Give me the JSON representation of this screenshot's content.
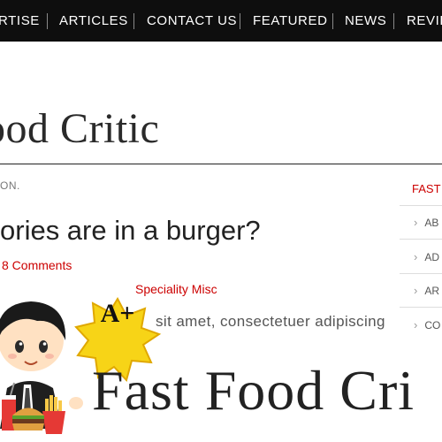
{
  "nav": {
    "items": [
      "RTISE",
      "ARTICLES",
      "CONTACT US",
      "FEATURED",
      "NEWS",
      "REVIE"
    ]
  },
  "header": {
    "site_title": "ood Critic"
  },
  "breadcrumb": {
    "tail": "ON."
  },
  "post": {
    "title": "ories are in a burger?",
    "comments": "8 Comments",
    "categories": "Speciality Misc",
    "excerpt_before": "",
    "excerpt_after": "sit amet, consectetuer adipiscing"
  },
  "sidebar": {
    "heading": "FAST",
    "items": [
      "AB",
      "AD",
      "AR",
      "CO"
    ]
  },
  "promo": {
    "badge": "A+",
    "title": "Fast Food Cri"
  },
  "colors": {
    "nav_bg": "#0e0e0e",
    "link_red": "#cc0000",
    "badge_yellow": "#f7d417"
  }
}
